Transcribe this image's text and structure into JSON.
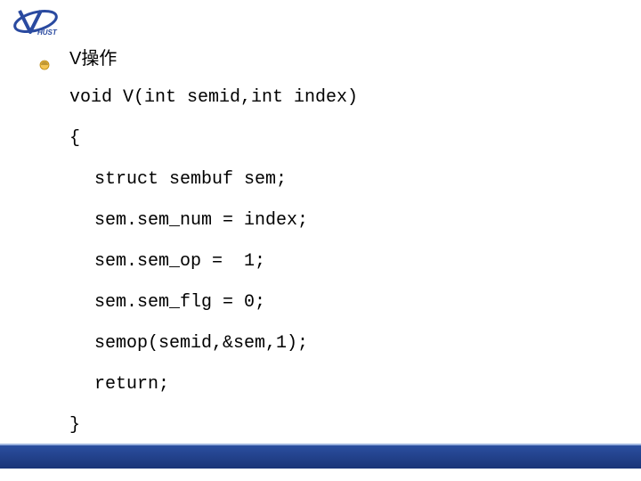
{
  "slide": {
    "heading": "V操作",
    "code": {
      "l1": "void V(int semid,int index)",
      "l2": "{",
      "l3": "struct sembuf sem;",
      "l4": "sem.sem_num = index;",
      "l5": "sem.sem_op =  1;",
      "l6": "sem.sem_flg = 0;",
      "l7": "semop(semid,&sem,1);",
      "l8": "return;",
      "l9": "}"
    }
  }
}
